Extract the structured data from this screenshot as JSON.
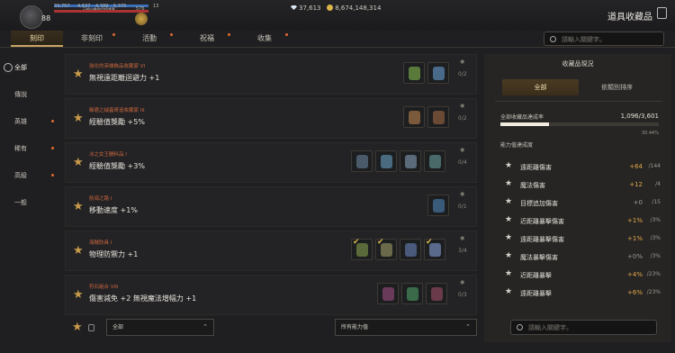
{
  "player": {
    "level": "88",
    "stats": [
      "33,757",
      "4,637",
      "4,399",
      "5,375",
      "576",
      "13"
    ],
    "bar_text": "已經自動取用保護套"
  },
  "currency": {
    "diamond": "37,613",
    "gold": "8,674,148,314"
  },
  "page_title": "道具收藏品",
  "tabs": [
    "刻印",
    "非刻印",
    "活動",
    "祝福",
    "收集"
  ],
  "active_tab": 0,
  "search": {
    "placeholder": "請輸入關鍵字。"
  },
  "sidebar": [
    "全部",
    "傳說",
    "英雄",
    "稀有",
    "高級",
    "一般"
  ],
  "collections": [
    {
      "subtitle": "強化的英雄飾品收藏家 VI",
      "name": "無視遠距離迴避力 +1",
      "count": "0/2",
      "items": [
        {
          "color": "#5a7a3c",
          "checked": false
        },
        {
          "color": "#4a6a8a",
          "checked": false
        }
      ]
    },
    {
      "subtitle": "躲避之絨蟲哥追收藏家 III",
      "name": "經驗值獎勵 +5%",
      "count": "0/2",
      "items": [
        {
          "color": "#7a5a3a",
          "checked": false
        },
        {
          "color": "#6a4a34",
          "checked": false
        }
      ]
    },
    {
      "subtitle": "冰之女王酬料品 I",
      "name": "經驗值獎勵 +3%",
      "count": "0/4",
      "items": [
        {
          "color": "#4a5a6a",
          "checked": false
        },
        {
          "color": "#4a6a80",
          "checked": false
        },
        {
          "color": "#5a6a7a",
          "checked": false
        },
        {
          "color": "#4a6a6a",
          "checked": false
        }
      ]
    },
    {
      "subtitle": "航海之路 I",
      "name": "移動速度 +1%",
      "count": "0/1",
      "items": [
        {
          "color": "#3a5a7a",
          "checked": false
        }
      ]
    },
    {
      "subtitle": "海賊防具 I",
      "name": "物理防禦力 +1",
      "count": "3/4",
      "items": [
        {
          "color": "#5a6a3a",
          "checked": true
        },
        {
          "color": "#6a6a4a",
          "checked": true
        },
        {
          "color": "#4a5a7a",
          "checked": false
        },
        {
          "color": "#5a6a8a",
          "checked": true
        }
      ]
    },
    {
      "subtitle": "符石組合 VIII",
      "name": "傷害減免 +2 無視魔法增幅力 +1",
      "count": "0/3",
      "items": [
        {
          "color": "#6a3a5a",
          "checked": false
        },
        {
          "color": "#3a6a4a",
          "checked": false
        },
        {
          "color": "#6a3a4a",
          "checked": false
        }
      ]
    }
  ],
  "bottom_bar": {
    "filter_all": "全部",
    "filter_stats": "所有能力值"
  },
  "right_panel": {
    "header": "收藏品現況",
    "tabs": [
      "全部",
      "依類別排序"
    ],
    "rate_label": "全部收藏品達成率",
    "rate_value": "1,096/3,601",
    "rate_percent": "30.44%",
    "rate_fraction": 0.3044,
    "bonus_label": "能力值達成度",
    "bonuses": [
      {
        "name": "遠距離傷害",
        "value": "+64",
        "max": "/144"
      },
      {
        "name": "魔法傷害",
        "value": "+12",
        "max": "/4"
      },
      {
        "name": "目標追加傷害",
        "value": "+0",
        "max": "/15"
      },
      {
        "name": "近距離暴擊傷害",
        "value": "+1%",
        "max": "/3%"
      },
      {
        "name": "遠距離暴擊傷害",
        "value": "+1%",
        "max": "/3%"
      },
      {
        "name": "魔法暴擊傷害",
        "value": "+0%",
        "max": "/3%"
      },
      {
        "name": "近距離暴擊",
        "value": "+4%",
        "max": "/23%"
      },
      {
        "name": "遠距離暴擊",
        "value": "+6%",
        "max": "/23%"
      }
    ]
  },
  "colors": {
    "accent": "#c9a466",
    "alert_dot": "#e06a30",
    "star": "#c79a4a",
    "bonus_value": "#e3a548"
  }
}
